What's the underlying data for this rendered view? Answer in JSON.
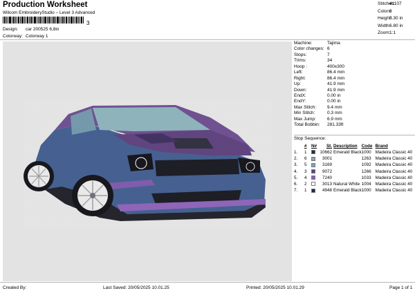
{
  "header": {
    "title": "Production Worksheet",
    "subtitle": "Wilcom EmbroideryStudio – Level 3 Advanced",
    "barcode_mark": "3",
    "design_label": "Design:",
    "design_value": "car 200525 6,8in",
    "colorway_label": "Colorway:",
    "colorway_value": "Colorway 1"
  },
  "stats": [
    {
      "label": "Stitches:",
      "value": "41107"
    },
    {
      "label": "Colors:",
      "value": "6"
    },
    {
      "label": "Height:",
      "value": "3.30 in"
    },
    {
      "label": "Width:",
      "value": "6.80 in"
    },
    {
      "label": "Zoom:",
      "value": "1:1"
    }
  ],
  "properties": [
    {
      "label": "Machine:",
      "value": "Tajima"
    },
    {
      "label": "Color changes:",
      "value": "6"
    },
    {
      "label": "Stops:",
      "value": "7"
    },
    {
      "label": "Trims:",
      "value": "34"
    },
    {
      "label": "Hoop :",
      "value": "400x300"
    },
    {
      "label": "Left:",
      "value": "86.4 mm"
    },
    {
      "label": "Right:",
      "value": "86.4 mm"
    },
    {
      "label": "Up:",
      "value": "41.9 mm"
    },
    {
      "label": "Down:",
      "value": "41.9 mm"
    },
    {
      "label": "EndX:",
      "value": "0.00 in"
    },
    {
      "label": "EndY:",
      "value": "0.00 in"
    },
    {
      "label": "Max Stitch:",
      "value": "9.4 mm"
    },
    {
      "label": "Min Stitch:",
      "value": "0.3 mm"
    },
    {
      "label": "Max Jump:",
      "value": "6.9 mm"
    },
    {
      "label": "Total Bobbin:",
      "value": "281.33ft"
    }
  ],
  "stop_sequence": {
    "heading": "Stop Sequence:",
    "columns": {
      "n": "#",
      "num": "N#",
      "st": "St.",
      "description": "Description",
      "code": "Code",
      "brand": "Brand"
    },
    "rows": [
      {
        "stop": "1.",
        "n": "1",
        "color": "#1e2a4a",
        "st": "10662",
        "description": "Emerald Black",
        "code": "1000",
        "brand": "Madeira Classic 40"
      },
      {
        "stop": "2.",
        "n": "6",
        "color": "#8da2b5",
        "st": "3001",
        "description": "",
        "code": "1263",
        "brand": "Madeira Classic 40"
      },
      {
        "stop": "3.",
        "n": "5",
        "color": "#7aa5c4",
        "st": "3169",
        "description": "",
        "code": "1092",
        "brand": "Madeira Classic 40"
      },
      {
        "stop": "4.",
        "n": "3",
        "color": "#5b3f8a",
        "st": "9072",
        "description": "",
        "code": "1266",
        "brand": "Madeira Classic 40"
      },
      {
        "stop": "5.",
        "n": "4",
        "color": "#8a5fb5",
        "st": "7240",
        "description": "",
        "code": "1033",
        "brand": "Madeira Classic 40"
      },
      {
        "stop": "6.",
        "n": "2",
        "color": "#ffffff",
        "st": "3013",
        "description": "Natural White",
        "code": "1004",
        "brand": "Madeira Classic 40"
      },
      {
        "stop": "7.",
        "n": "1",
        "color": "#1e2a4a",
        "st": "4948",
        "description": "Emerald Black",
        "code": "1000",
        "brand": "Madeira Classic 40"
      }
    ]
  },
  "footer": {
    "created": "Created By:",
    "saved": "Last Saved: 20/05/2025 10.01.25",
    "printed": "Printed: 20/05/2025 10.01.29",
    "page": "Page 1 of 1"
  },
  "colors": {
    "body_blue": "#3e5a8c",
    "body_purple": "#6a4a8c",
    "windshield": "#8ab0b8",
    "background": "#e3e3e3"
  }
}
